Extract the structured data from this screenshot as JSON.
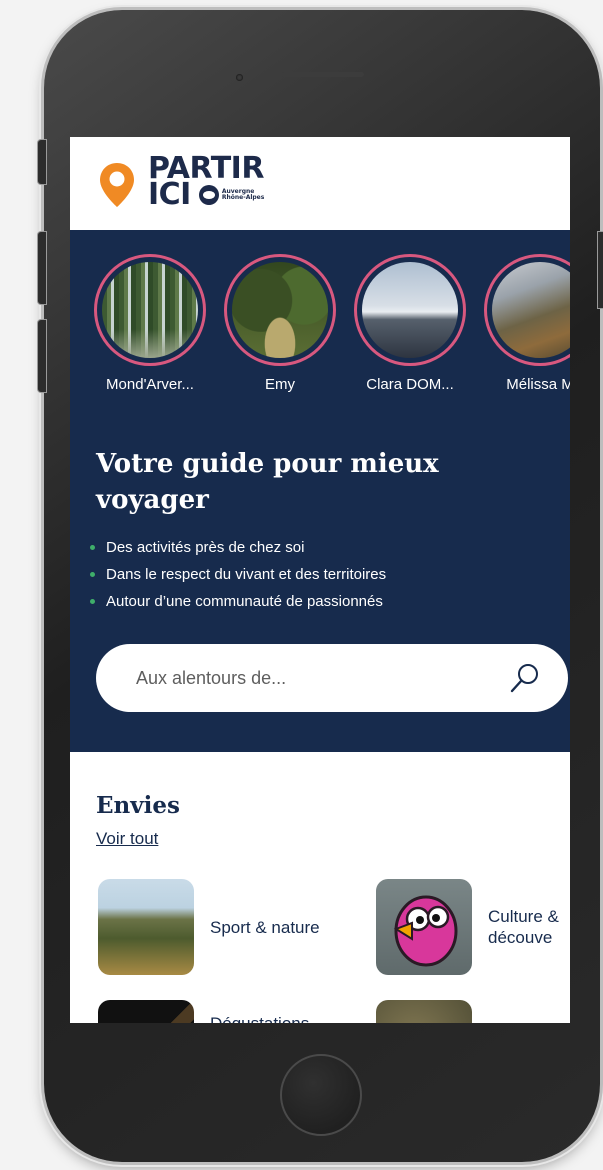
{
  "logo": {
    "line1": "PARTIR",
    "line2": "ICI",
    "region_line1": "Auvergne",
    "region_line2": "Rhône-Alpes"
  },
  "stories": [
    {
      "name": "Mond'Arver..."
    },
    {
      "name": "Emy"
    },
    {
      "name": "Clara DOM..."
    },
    {
      "name": "Mélissa M"
    }
  ],
  "hero": {
    "headline": "Votre guide pour mieux voyager",
    "bullets": [
      "Des activités près de chez soi",
      "Dans le respect du vivant et des territoires",
      "Autour d’une communauté de passionnés"
    ]
  },
  "search": {
    "placeholder": "Aux alentours de..."
  },
  "envies": {
    "title": "Envies",
    "see_all": "Voir tout",
    "categories": [
      {
        "label": "Sport & nature"
      },
      {
        "label": "Culture &\ndécouve"
      },
      {
        "label": "Dégustations"
      },
      {
        "label": ""
      }
    ]
  },
  "colors": {
    "navy": "#172b4d",
    "accent_orange": "#f08a24",
    "story_ring": "#d8587f",
    "bullet_green": "#3fae6a"
  },
  "icons": {
    "search": "magnifier-icon",
    "logo_pin": "location-pin-icon"
  }
}
